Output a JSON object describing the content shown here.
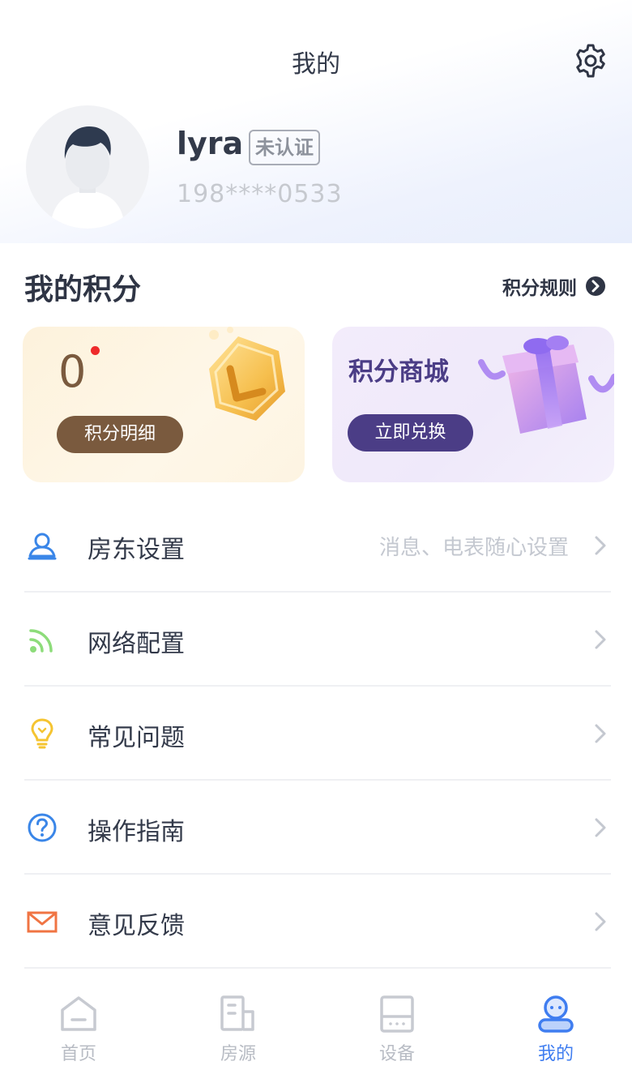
{
  "header": {
    "title": "我的"
  },
  "profile": {
    "username": "lyra",
    "verify_badge": "未认证",
    "phone": "198****0533"
  },
  "points": {
    "heading": "我的积分",
    "rules_label": "积分规则",
    "value": "0",
    "detail_button": "积分明细",
    "mall_title": "积分商城",
    "redeem_button": "立即兑换"
  },
  "menu": {
    "items": [
      {
        "label": "房东设置",
        "hint": "消息、电表随心设置",
        "icon": "person-icon",
        "color": "#3a86e8"
      },
      {
        "label": "网络配置",
        "hint": "",
        "icon": "wifi-icon",
        "color": "#8ddc7a"
      },
      {
        "label": "常见问题",
        "hint": "",
        "icon": "lightbulb-icon",
        "color": "#f5c431"
      },
      {
        "label": "操作指南",
        "hint": "",
        "icon": "question-icon",
        "color": "#3a86e8"
      },
      {
        "label": "意见反馈",
        "hint": "",
        "icon": "mail-icon",
        "color": "#f07443"
      }
    ]
  },
  "tabbar": {
    "tabs": [
      {
        "label": "首页",
        "icon": "home-icon",
        "active": false
      },
      {
        "label": "房源",
        "icon": "building-icon",
        "active": false
      },
      {
        "label": "设备",
        "icon": "device-icon",
        "active": false
      },
      {
        "label": "我的",
        "icon": "profile-icon",
        "active": true
      }
    ]
  },
  "colors": {
    "accent": "#3f7df0",
    "brown": "#7a5a3e",
    "purple": "#4b3d86",
    "red_dot": "#ee2b2b"
  }
}
